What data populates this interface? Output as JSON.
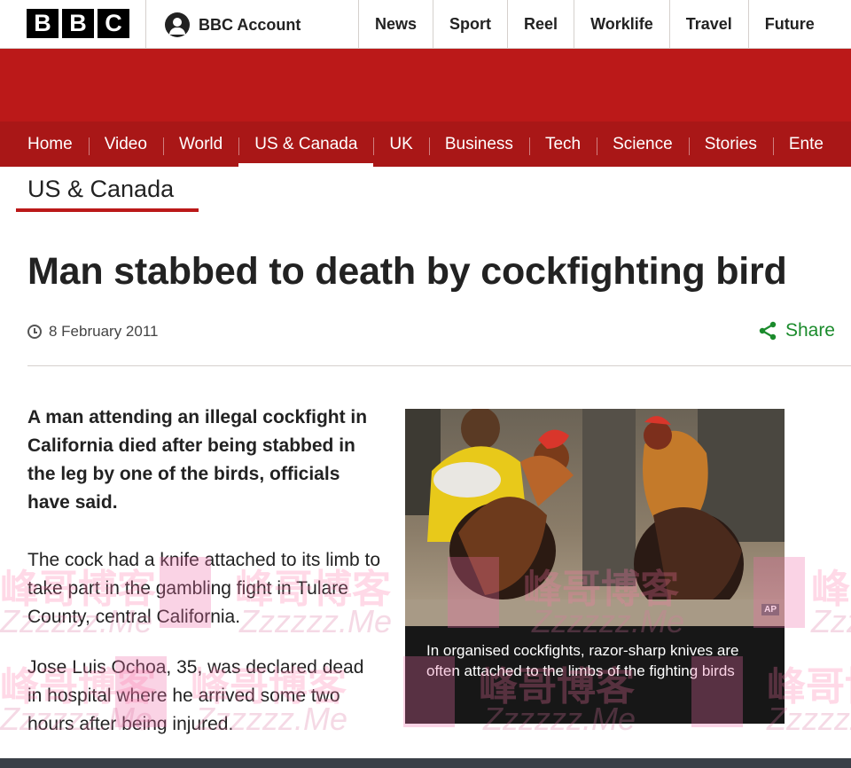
{
  "brand": {
    "logo_letters": [
      "B",
      "B",
      "C"
    ]
  },
  "account": {
    "label": "BBC Account"
  },
  "top_nav": [
    "News",
    "Sport",
    "Reel",
    "Worklife",
    "Travel",
    "Future"
  ],
  "section_nav": [
    "Home",
    "Video",
    "World",
    "US & Canada",
    "UK",
    "Business",
    "Tech",
    "Science",
    "Stories",
    "Ente"
  ],
  "section_nav_active": "US & Canada",
  "section_title": "US & Canada",
  "article": {
    "headline": "Man stabbed to death by cockfighting bird",
    "date": "8 February 2011",
    "share_label": "Share",
    "lead": "A man attending an illegal cockfight in California died after being stabbed in the leg by one of the birds, officials have said.",
    "paragraphs": [
      "The cock had a knife attached to its limb to take part in the gambling fight in Tulare County, central California.",
      "Jose Luis Ochoa, 35, was declared dead in hospital where he arrived some two hours after being injured."
    ],
    "image": {
      "credit": "AP",
      "caption": "In organised cockfights, razor-sharp knives are often attached to the limbs of the fighting birds"
    }
  },
  "watermark": {
    "cn": "峰哥博客",
    "en": "Zzzzzz.Me"
  },
  "colors": {
    "brand_red": "#bb1919",
    "nav_red": "#a91717",
    "share_green": "#1b8b2c",
    "text": "#222222"
  }
}
